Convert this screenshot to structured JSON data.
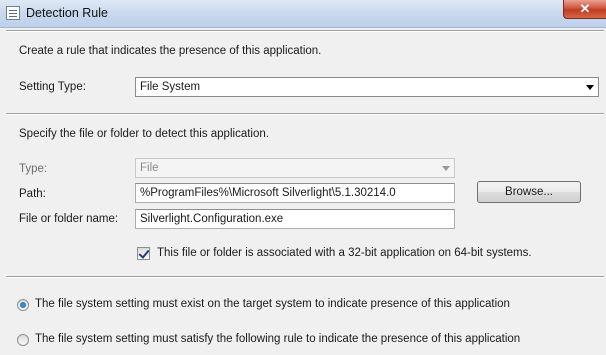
{
  "window": {
    "title": "Detection Rule",
    "close_symbol": "✕"
  },
  "intro": "Create a rule that indicates the presence of this application.",
  "setting_type": {
    "label": "Setting Type:",
    "value": "File System"
  },
  "specify_text": "Specify the file or folder to detect this application.",
  "form": {
    "type_label": "Type:",
    "type_value": "File",
    "path_label": "Path:",
    "path_value": "%ProgramFiles%\\Microsoft Silverlight\\5.1.30214.0",
    "browse_label": "Browse...",
    "name_label": "File or folder name:",
    "name_value": "Silverlight.Configuration.exe",
    "checkbox_label": "This file or folder is associated with a 32-bit application on 64-bit systems.",
    "checkbox_checked": true
  },
  "options": [
    {
      "label": "The file system setting must exist on the target system to indicate presence of this application",
      "selected": true
    },
    {
      "label": "The file system setting must satisfy the following rule to indicate the presence of this application",
      "selected": false
    }
  ]
}
